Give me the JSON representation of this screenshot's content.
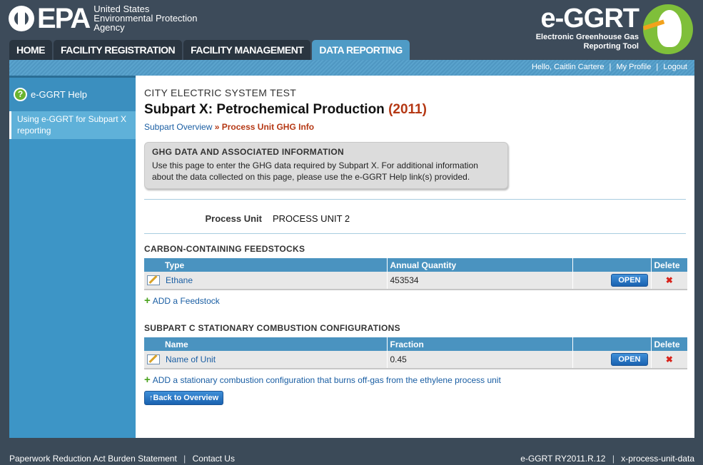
{
  "header": {
    "epa_mark": "EPA",
    "epa_sub_1": "United States",
    "epa_sub_2": "Environmental Protection",
    "epa_sub_3": "Agency",
    "eggrt_mark": "e-GGRT",
    "eggrt_sub_1": "Electronic Greenhouse Gas",
    "eggrt_sub_2": "Reporting Tool"
  },
  "nav": {
    "tabs": [
      {
        "label": "HOME"
      },
      {
        "label": "FACILITY REGISTRATION"
      },
      {
        "label": "FACILITY MANAGEMENT"
      },
      {
        "label": "DATA REPORTING"
      }
    ],
    "active_tab": "DATA REPORTING"
  },
  "userbar": {
    "greeting": "Hello, Caitlin Cartere",
    "profile": "My Profile",
    "logout": "Logout"
  },
  "sidebar": {
    "help_label": "e-GGRT Help",
    "help_item": "Using e-GGRT for Subpart X reporting"
  },
  "main": {
    "facility": "CITY ELECTRIC SYSTEM TEST",
    "title": "Subpart X: Petrochemical Production",
    "year": "(2011)",
    "crumb_overview": "Subpart Overview",
    "crumb_current": "Process Unit GHG Info",
    "info_head": "GHG DATA AND ASSOCIATED INFORMATION",
    "info_body": "Use this page to enter the GHG data required by Subpart X. For additional information about the data collected on this page, please use the e-GGRT Help link(s) provided.",
    "process_unit_label": "Process Unit",
    "process_unit_value": "PROCESS UNIT 2",
    "feedstocks": {
      "title": "CARBON-CONTAINING FEEDSTOCKS",
      "headers": [
        "Type",
        "Annual Quantity",
        "",
        "Delete"
      ],
      "rows": [
        {
          "name": "Ethane",
          "value": "453534",
          "open": "OPEN"
        }
      ],
      "add_label": "ADD a Feedstock"
    },
    "combustion": {
      "title": "SUBPART C STATIONARY COMBUSTION CONFIGURATIONS",
      "headers": [
        "Name",
        "Fraction",
        "",
        "Delete"
      ],
      "rows": [
        {
          "name": "Name of Unit",
          "value": "0.45",
          "open": "OPEN"
        }
      ],
      "add_label": "ADD a stationary combustion configuration that burns off-gas from the ethylene process unit"
    },
    "back_label": "Back to Overview"
  },
  "footer": {
    "paperwork": "Paperwork Reduction Act Burden Statement",
    "contact": "Contact Us",
    "version": "e-GGRT RY2011.R.12",
    "page_id": "x-process-unit-data"
  }
}
